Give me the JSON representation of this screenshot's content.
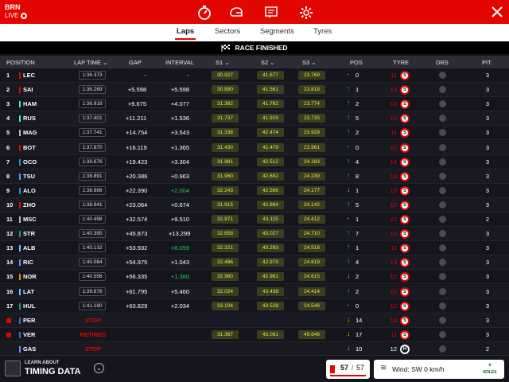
{
  "header": {
    "session": "BRN",
    "live": "LIVE"
  },
  "tabs": [
    {
      "label": "Laps",
      "active": true
    },
    {
      "label": "Sectors"
    },
    {
      "label": "Segments"
    },
    {
      "label": "Tyres"
    }
  ],
  "status": "RACE FINISHED",
  "columns": {
    "position": "POSITION",
    "lap_time": "LAP TIME",
    "gap": "GAP",
    "interval": "INTERVAL",
    "s1": "S1",
    "s2": "S2",
    "s3": "S3",
    "pos": "POS",
    "tyre": "TYRE",
    "drs": "DRS",
    "pit": "PIT"
  },
  "rows": [
    {
      "num": "1",
      "driver": "LEC",
      "team_color": "#e10600",
      "lap": "1:36.373",
      "gap": "-",
      "interval": "-",
      "s1": "30.927",
      "s2": "41.677",
      "s3": "23.769",
      "dir": "eq",
      "pos": "0",
      "tyre_laps": "11",
      "tyre": "S",
      "pit": "3"
    },
    {
      "num": "2",
      "driver": "SAI",
      "team_color": "#e10600",
      "lap": "1:36.269",
      "gap": "+5.598",
      "interval": "+5.598",
      "s1": "30.890",
      "s2": "41.561",
      "s3": "23.818",
      "dir": "up",
      "pos": "1",
      "tyre_laps": "13",
      "tyre": "S",
      "pit": "3"
    },
    {
      "num": "3",
      "driver": "HAM",
      "team_color": "#27f4d2",
      "lap": "1:36.918",
      "gap": "+9.675",
      "interval": "+4.077",
      "s1": "31.382",
      "s2": "41.762",
      "s3": "23.774",
      "dir": "up",
      "pos": "2",
      "tyre_laps": "13",
      "tyre": "S",
      "pit": "3"
    },
    {
      "num": "4",
      "driver": "RUS",
      "team_color": "#27f4d2",
      "lap": "1:37.401",
      "gap": "+11.211",
      "interval": "+1.536",
      "s1": "31.737",
      "s2": "41.929",
      "s3": "23.735",
      "dir": "up",
      "pos": "5",
      "tyre_laps": "12",
      "tyre": "S",
      "pit": "3"
    },
    {
      "num": "5",
      "driver": "MAG",
      "team_color": "#b6babd",
      "lap": "1:37.741",
      "gap": "+14.754",
      "interval": "+3.543",
      "s1": "31.338",
      "s2": "42.474",
      "s3": "23.929",
      "dir": "up",
      "pos": "2",
      "tyre_laps": "11",
      "tyre": "S",
      "pit": "3"
    },
    {
      "num": "6",
      "driver": "BOT",
      "team_color": "#e10600",
      "lap": "1:37.870",
      "gap": "+16.119",
      "interval": "+1.365",
      "s1": "31.430",
      "s2": "42.479",
      "s3": "23.961",
      "dir": "eq",
      "pos": "0",
      "tyre_laps": "12",
      "tyre": "S",
      "pit": "3"
    },
    {
      "num": "7",
      "driver": "OCO",
      "team_color": "#2293d1",
      "lap": "1:38.676",
      "gap": "+19.423",
      "interval": "+3.304",
      "s1": "31.981",
      "s2": "42.512",
      "s3": "24.183",
      "dir": "up",
      "pos": "4",
      "tyre_laps": "14",
      "tyre": "S",
      "pit": "3"
    },
    {
      "num": "8",
      "driver": "TSU",
      "team_color": "#6692ff",
      "lap": "1:38.891",
      "gap": "+20.386",
      "interval": "+0.963",
      "s1": "31.960",
      "s2": "42.692",
      "s3": "24.239",
      "dir": "up",
      "pos": "8",
      "tyre_laps": "13",
      "tyre": "S",
      "pit": "3"
    },
    {
      "num": "9",
      "driver": "ALO",
      "team_color": "#2293d1",
      "lap": "1:38.986",
      "gap": "+22.390",
      "interval": "+2.004",
      "interval_green": true,
      "s1": "32.243",
      "s2": "42.566",
      "s3": "24.177",
      "dir": "dn",
      "pos": "1",
      "tyre_laps": "15",
      "tyre": "S",
      "pit": "3"
    },
    {
      "num": "10",
      "driver": "ZHO",
      "team_color": "#e10600",
      "lap": "1:38.941",
      "gap": "+23.064",
      "interval": "+0.674",
      "s1": "31.915",
      "s2": "42.884",
      "s3": "24.142",
      "dir": "up",
      "pos": "5",
      "tyre_laps": "12",
      "tyre": "S",
      "pit": "3"
    },
    {
      "num": "11",
      "driver": "MSC",
      "team_color": "#b6babd",
      "lap": "1:40.498",
      "gap": "+32.574",
      "interval": "+9.510",
      "s1": "32.971",
      "s2": "43.115",
      "s3": "24.412",
      "dir": "eq",
      "pos": "1",
      "tyre_laps": "22",
      "tyre": "S",
      "pit": "2"
    },
    {
      "num": "12",
      "driver": "STR",
      "team_color": "#229971",
      "lap": "1:40.395",
      "gap": "+45.873",
      "interval": "+13.299",
      "s1": "32.658",
      "s2": "43.027",
      "s3": "24.710",
      "dir": "up",
      "pos": "7",
      "tyre_laps": "12",
      "tyre": "S",
      "pit": "3"
    },
    {
      "num": "13",
      "driver": "ALB",
      "team_color": "#64c4ff",
      "lap": "1:40.132",
      "gap": "+53.932",
      "interval": "+8.059",
      "interval_green": true,
      "s1": "32.321",
      "s2": "43.293",
      "s3": "24.518",
      "dir": "up",
      "pos": "1",
      "tyre_laps": "11",
      "tyre": "S",
      "pit": "3"
    },
    {
      "num": "14",
      "driver": "RIC",
      "team_color": "#6692ff",
      "lap": "1:40.084",
      "gap": "+54.975",
      "interval": "+1.043",
      "s1": "32.486",
      "s2": "42.979",
      "s3": "24.619",
      "dir": "up",
      "pos": "4",
      "tyre_laps": "13",
      "tyre": "S",
      "pit": "3"
    },
    {
      "num": "15",
      "driver": "NOR",
      "team_color": "#ff8000",
      "lap": "1:40.556",
      "gap": "+56.335",
      "interval": "+1.360",
      "interval_green": true,
      "s1": "32.980",
      "s2": "42.961",
      "s3": "24.615",
      "dir": "dn",
      "pos": "2",
      "tyre_laps": "12",
      "tyre": "S",
      "pit": "3"
    },
    {
      "num": "16",
      "driver": "LAT",
      "team_color": "#64c4ff",
      "lap": "1:39.876",
      "gap": "+61.795",
      "interval": "+5.460",
      "s1": "32.024",
      "s2": "43.438",
      "s3": "24.414",
      "dir": "up",
      "pos": "2",
      "tyre_laps": "12",
      "tyre": "S",
      "pit": "3"
    },
    {
      "num": "17",
      "driver": "HUL",
      "team_color": "#229971",
      "lap": "1:41.180",
      "gap": "+63.829",
      "interval": "+2.034",
      "s1": "33.104",
      "s2": "43.528",
      "s3": "24.548",
      "dir": "eq",
      "pos": "0",
      "tyre_laps": "12",
      "tyre": "S",
      "pit": "3"
    },
    {
      "num": "",
      "driver": "PER",
      "team_color": "#3671c6",
      "lap": "STOP",
      "lap_stop": true,
      "gap": "",
      "interval": "",
      "s1": "",
      "s2": "",
      "s3": "",
      "dir": "dn",
      "pos": "14",
      "tyre_laps": "13",
      "tyre": "S",
      "pit": "3",
      "num_icon": true
    },
    {
      "num": "",
      "driver": "VER",
      "team_color": "#3671c6",
      "lap": "RETIRED",
      "lap_stop": true,
      "gap": "",
      "interval": "",
      "s1": "31.367",
      "s2": "43.081",
      "s3": "49.646",
      "dir": "dn",
      "pos": "17",
      "tyre_laps": "11",
      "tyre": "S",
      "pit": "3",
      "num_icon": true
    },
    {
      "num": "",
      "driver": "GAS",
      "team_color": "#6692ff",
      "lap": "STOP",
      "lap_stop": true,
      "gap": "",
      "interval": "",
      "s1": "",
      "s2": "",
      "s3": "",
      "dir": "dn",
      "pos": "10",
      "tyre_laps": "12",
      "tyre": "H",
      "pit": "2"
    }
  ],
  "footer": {
    "learn_about": "LEARN ABOUT",
    "timing_data": "TIMING DATA",
    "lap_current": "57",
    "lap_total": "57",
    "lap_sep": "/",
    "wind": "Wind: SW 0 km/h",
    "sponsor": "ROLEX"
  }
}
